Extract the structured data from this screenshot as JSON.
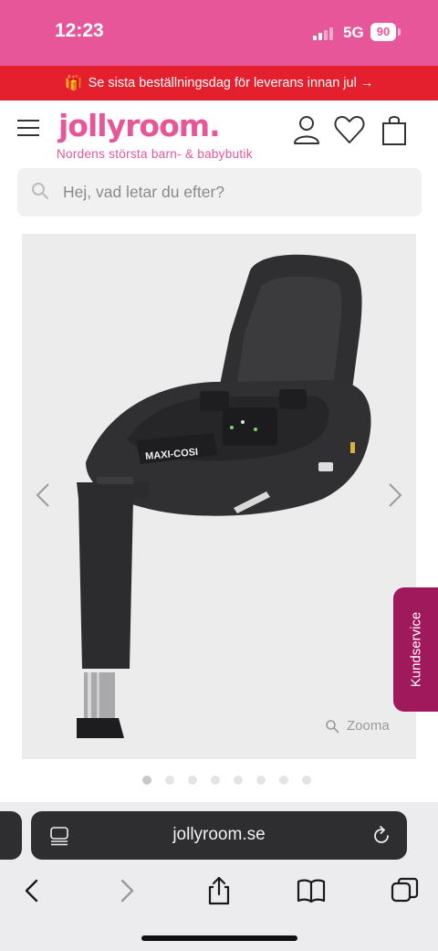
{
  "status": {
    "time": "12:23",
    "network": "5G",
    "battery": "90"
  },
  "promo": {
    "text": "Se sista beställningsdag för leverans innan jul →"
  },
  "header": {
    "logo": "jollyroom.",
    "tagline": "Nordens största barn- & babybutik"
  },
  "search": {
    "placeholder": "Hej, vad letar du efter?"
  },
  "gallery": {
    "zoom_label": "Zooma",
    "brand_on_product": "MAXI-COSI",
    "current_slide": 1,
    "total_slides": 8
  },
  "kundservice": {
    "label": "Kundservice"
  },
  "browser": {
    "url": "jollyroom.se"
  },
  "colors": {
    "brand": "#e8569a",
    "promo": "#e4202e",
    "kundservice": "#a0195c"
  }
}
